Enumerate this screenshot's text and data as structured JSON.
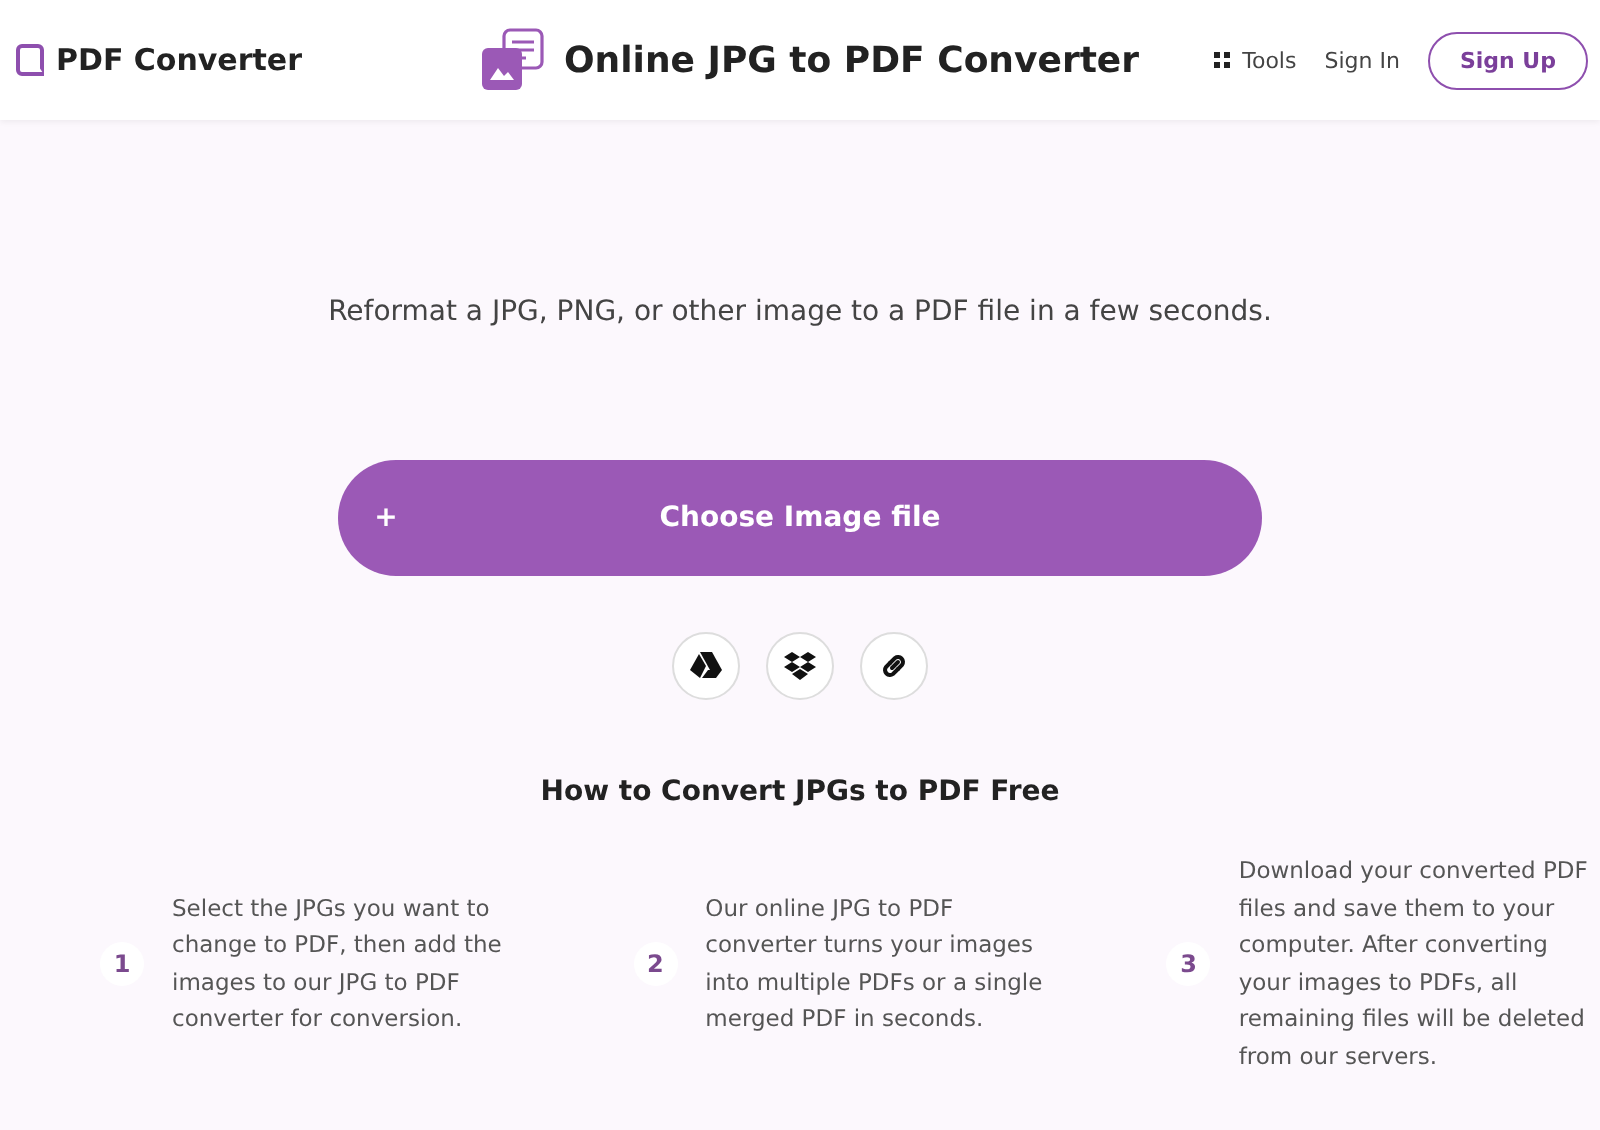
{
  "header": {
    "brand": "PDF Converter",
    "title": "Online JPG to PDF Converter",
    "nav": [
      {
        "kind": "tools",
        "label": "Tools"
      },
      {
        "kind": "link",
        "label": "Sign In"
      },
      {
        "kind": "outline",
        "label": "Sign Up"
      }
    ]
  },
  "tagline": "Reformat a JPG, PNG, or other image to a PDF file in a few seconds.",
  "upload": {
    "icon": "+",
    "label": "Choose Image file"
  },
  "sources": [
    {
      "kind": "drive"
    },
    {
      "kind": "dropbox"
    },
    {
      "kind": "link"
    }
  ],
  "how_to": {
    "heading": "How to Convert JPGs to PDF Free",
    "steps": [
      {
        "number": "1",
        "text": "Select the JPGs you want to change to PDF, then add the images to our JPG to PDF converter for conversion."
      },
      {
        "number": "2",
        "text": "Our online JPG to PDF converter turns your images into multiple PDFs or a single merged PDF in seconds."
      },
      {
        "number": "3",
        "text": "Download your converted PDF files and save them to your computer. After converting your images to PDFs, all remaining files will be deleted from our servers."
      }
    ]
  }
}
